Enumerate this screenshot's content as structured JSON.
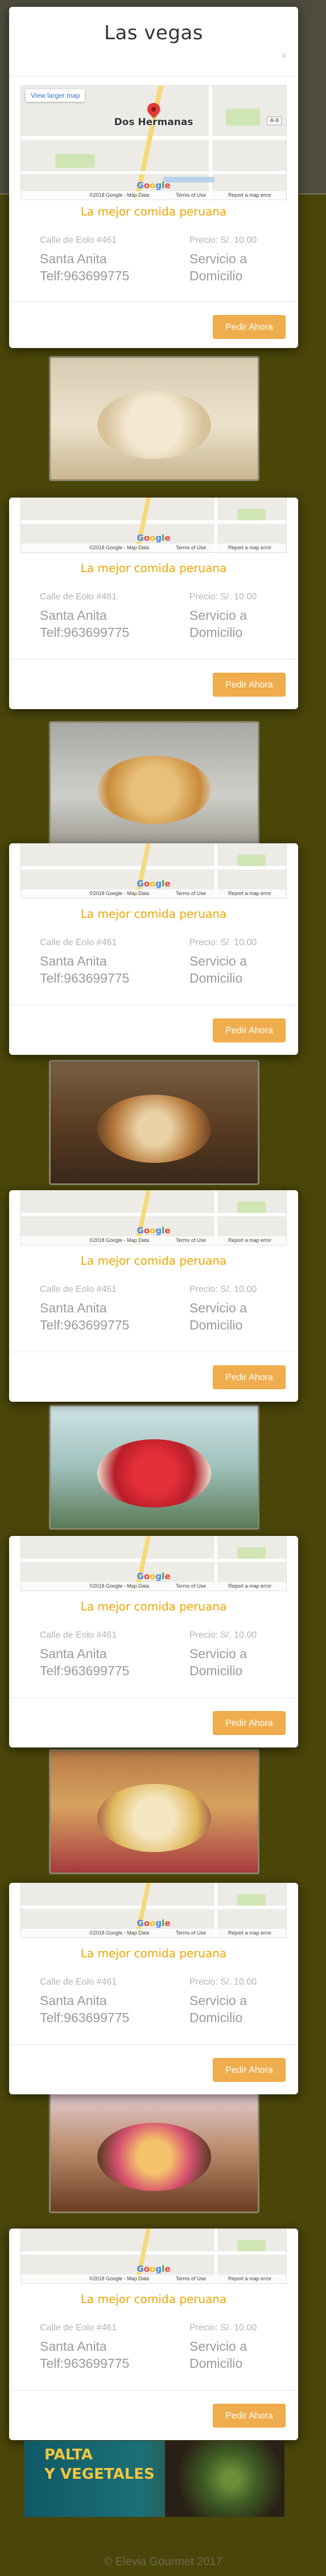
{
  "modal": {
    "title": "Las vegas",
    "close_glyph": "×",
    "map": {
      "link": "View larger map",
      "city": "Dos Hermanas",
      "badge": "A-8",
      "footer_data": "©2018 Google - Map Data",
      "footer_terms": "Terms of Use",
      "footer_report": "Report a map error",
      "logo_letters": [
        "G",
        "o",
        "o",
        "g",
        "l",
        "e"
      ]
    },
    "tagline": "La mejor comida peruana",
    "address_label": "Calle de Eolo #461",
    "district": "Santa Anita",
    "phone": "Telf:963699775",
    "price_label": "Precio: S/. 10.00",
    "service_line1": "Servicio a",
    "service_line2": "Domicilio",
    "order_button": "Pedir Ahora"
  },
  "banner": {
    "line1": "PALTA",
    "line2": "Y VEGETALES"
  },
  "footer": "© Elevia Gourmet 2017",
  "colors": {
    "background": "#4a4509",
    "accent": "#f0a500",
    "button": "#f0ad4e"
  }
}
